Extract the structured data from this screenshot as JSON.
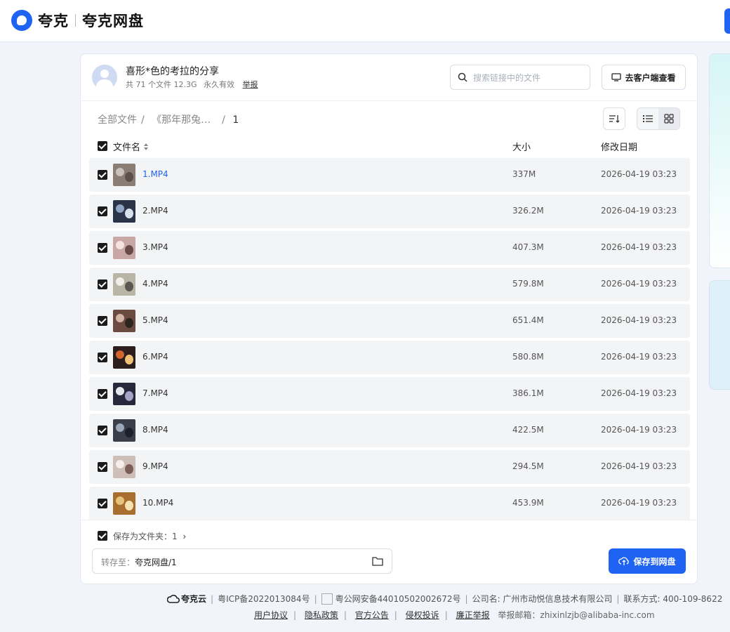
{
  "header": {
    "brand_left": "夸克",
    "brand_right": "夸克网盘"
  },
  "share": {
    "title": "喜形*色的考拉的分享",
    "file_count": "共 71 个文件 12.3G",
    "validity": "永久有效",
    "report": "举报",
    "search_placeholder": "搜索链接中的文件",
    "client_button": "去客户端查看"
  },
  "breadcrumb": {
    "root": "全部文件",
    "parent": "《那年那兔…",
    "current": "1"
  },
  "table": {
    "headers": {
      "name": "文件名",
      "size": "大小",
      "date": "修改日期"
    },
    "rows": [
      {
        "name": "1.MP4",
        "size": "337M",
        "date": "2026-04-19 03:23"
      },
      {
        "name": "2.MP4",
        "size": "326.2M",
        "date": "2026-04-19 03:23"
      },
      {
        "name": "3.MP4",
        "size": "407.3M",
        "date": "2026-04-19 03:23"
      },
      {
        "name": "4.MP4",
        "size": "579.8M",
        "date": "2026-04-19 03:23"
      },
      {
        "name": "5.MP4",
        "size": "651.4M",
        "date": "2026-04-19 03:23"
      },
      {
        "name": "6.MP4",
        "size": "580.8M",
        "date": "2026-04-19 03:23"
      },
      {
        "name": "7.MP4",
        "size": "386.1M",
        "date": "2026-04-19 03:23"
      },
      {
        "name": "8.MP4",
        "size": "422.5M",
        "date": "2026-04-19 03:23"
      },
      {
        "name": "9.MP4",
        "size": "294.5M",
        "date": "2026-04-19 03:23"
      },
      {
        "name": "10.MP4",
        "size": "453.9M",
        "date": "2026-04-19 03:23"
      }
    ]
  },
  "save": {
    "folder_label": "保存为文件夹：1",
    "transfer_label": "转存至：",
    "transfer_path": "夸克网盘/1",
    "save_button": "保存到网盘"
  },
  "footer": {
    "logo": "夸克云",
    "icp": "粤ICP备2022013084号",
    "police": "粤公网安备44010502002672号",
    "company": "公司名: 广州市动悦信息技术有限公司",
    "contact": "联系方式: 400-109-8622",
    "links": [
      "用户协议",
      "隐私政策",
      "官方公告",
      "侵权投诉",
      "廉正举报"
    ],
    "email": "举报邮箱：zhixinlzjb@alibaba-inc.com"
  },
  "colors": {
    "accent": "#1e63f2",
    "row_bg": "#f3f4f6",
    "page_bg": "#f1f4fa"
  }
}
